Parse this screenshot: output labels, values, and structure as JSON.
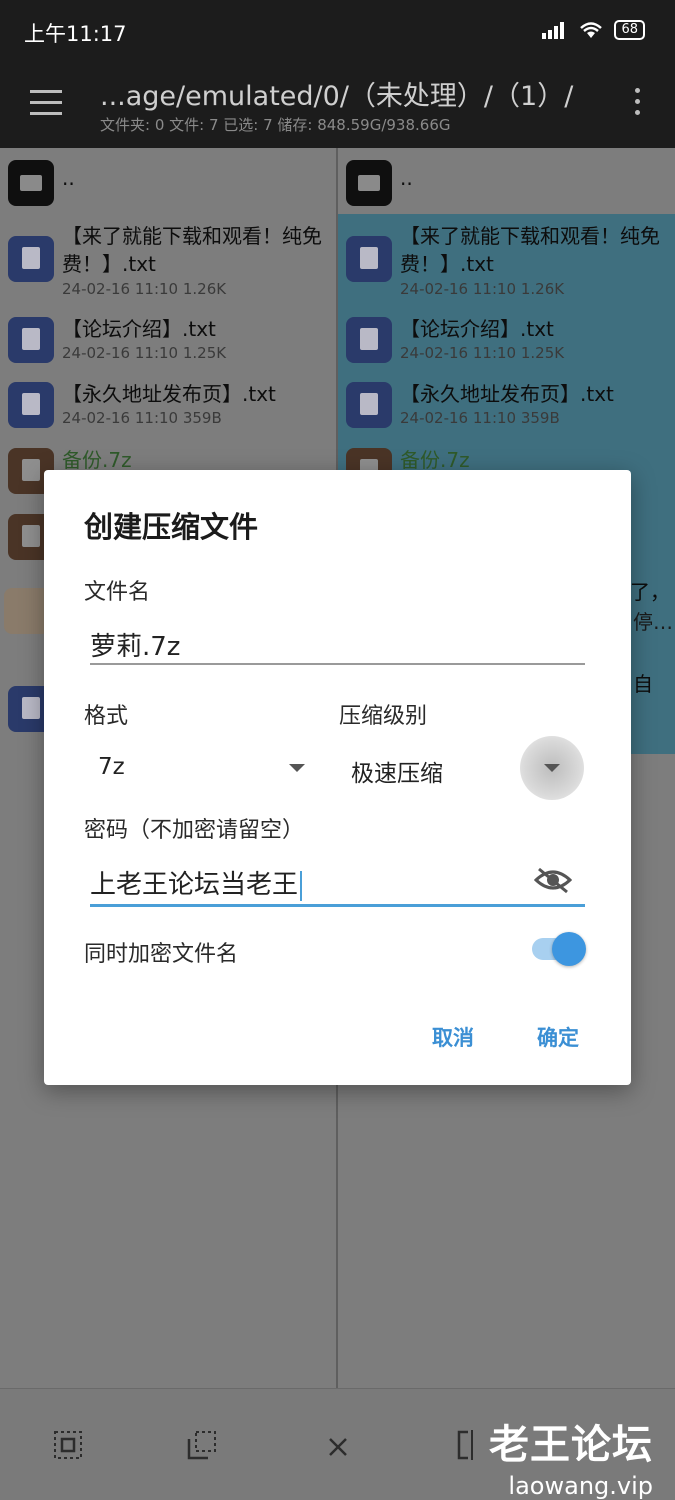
{
  "status_bar": {
    "time": "上午11:17",
    "battery": "68"
  },
  "toolbar": {
    "path": "...age/emulated/0/（未处理）/（1）/",
    "stats": "文件夹: 0  文件: 7  已选: 7  储存: 848.59G/938.66G"
  },
  "left_pane": {
    "items": [
      {
        "name": "..",
        "meta": "",
        "type": "folder"
      },
      {
        "name": "【来了就能下载和观看！纯免费！】.txt",
        "meta": "24-02-16 11:10  1.26K",
        "type": "doc"
      },
      {
        "name": "【论坛介绍】.txt",
        "meta": "24-02-16 11:10  1.25K",
        "type": "doc"
      },
      {
        "name": "【永久地址发布页】.txt",
        "meta": "24-02-16 11:10  359B",
        "type": "doc"
      },
      {
        "name": "备份.7z",
        "meta": "",
        "type": "archive"
      }
    ]
  },
  "right_pane": {
    "items": [
      {
        "name": "..",
        "meta": "",
        "type": "folder"
      },
      {
        "name": "【来了就能下载和观看！纯免费！】.txt",
        "meta": "24-02-16 11:10  1.26K",
        "type": "doc"
      },
      {
        "name": "【论坛介绍】.txt",
        "meta": "24-02-16 11:10  1.25K",
        "type": "doc"
      },
      {
        "name": "【永久地址发布页】.txt",
        "meta": "24-02-16 11:10  359B",
        "type": "doc"
      },
      {
        "name": "备份.7z",
        "meta": "",
        "type": "archive"
      }
    ],
    "partial_texts": [
      "了，",
      "停…",
      "自"
    ]
  },
  "dialog": {
    "title": "创建压缩文件",
    "filename_label": "文件名",
    "filename_value": "萝莉.7z",
    "format_label": "格式",
    "format_value": "7z",
    "level_label": "压缩级别",
    "level_value": "极速压缩",
    "password_label": "密码（不加密请留空）",
    "password_value": "上老王论坛当老王",
    "encrypt_names_label": "同时加密文件名",
    "encrypt_names_on": true,
    "cancel_label": "取消",
    "ok_label": "确定"
  },
  "bottom_bar": {
    "icons": [
      "select-all-icon",
      "select-partial-icon",
      "close-icon",
      "invert-selection-icon"
    ]
  },
  "watermark": {
    "title": "老王论坛",
    "url": "laowang.vip"
  },
  "colors": {
    "accent": "#3d96e0",
    "toolbar_bg": "#1c1c1c",
    "selected_bg": "#3f6f7f"
  }
}
